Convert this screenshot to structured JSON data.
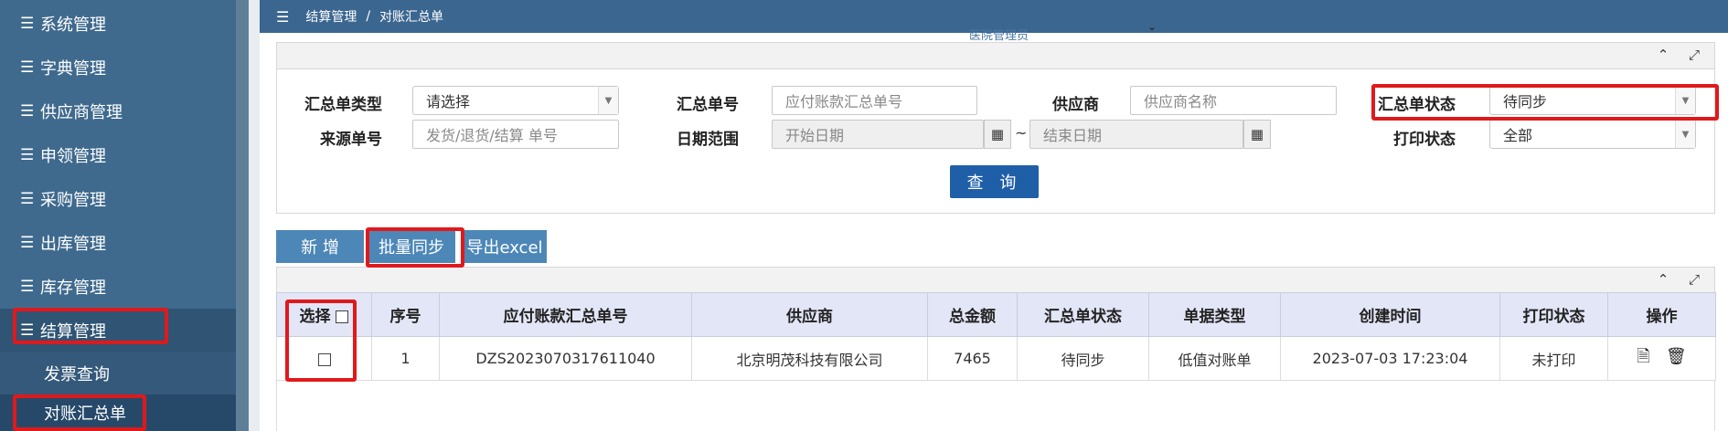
{
  "sidebar": {
    "items": [
      {
        "label": "系统管理",
        "icon": "list-icon"
      },
      {
        "label": "字典管理",
        "icon": "list-icon"
      },
      {
        "label": "供应商管理",
        "icon": "list-icon"
      },
      {
        "label": "申领管理",
        "icon": "list-icon"
      },
      {
        "label": "采购管理",
        "icon": "list-icon"
      },
      {
        "label": "出库管理",
        "icon": "list-icon"
      },
      {
        "label": "库存管理",
        "icon": "list-icon"
      },
      {
        "label": "结算管理",
        "icon": "list-icon"
      }
    ],
    "subitems": [
      {
        "label": "发票查询"
      },
      {
        "label": "对账汇总单"
      }
    ],
    "list_glyph": "☰"
  },
  "header": {
    "breadcrumb": [
      "结算管理",
      "对账汇总单"
    ],
    "separator": "/",
    "user": "医院管理员"
  },
  "search": {
    "type_label": "汇总单类型",
    "type_value": "请选择",
    "no_label": "汇总单号",
    "no_placeholder": "应付账款汇总单号",
    "supplier_label": "供应商",
    "supplier_placeholder": "供应商名称",
    "status_label": "汇总单状态",
    "status_value": "待同步",
    "source_label": "来源单号",
    "source_placeholder": "发货/退货/结算 单号",
    "date_label": "日期范围",
    "date_start_placeholder": "开始日期",
    "date_end_placeholder": "结束日期",
    "date_sep": "~",
    "print_label": "打印状态",
    "print_value": "全部",
    "query_label": "查 询"
  },
  "actions": {
    "add": "新 增",
    "batch_sync": "批量同步",
    "export": "导出excel"
  },
  "table": {
    "headers": [
      "选择",
      "序号",
      "应付账款汇总单号",
      "供应商",
      "总金额",
      "汇总单状态",
      "单据类型",
      "创建时间",
      "打印状态",
      "操作"
    ],
    "rows": [
      {
        "index": "1",
        "no": "DZS2023070317611040",
        "supplier": "北京明茂科技有限公司",
        "amount": "7465",
        "status": "待同步",
        "type": "低值对账单",
        "created": "2023-07-03 17:23:04",
        "print": "未打印"
      }
    ]
  },
  "colors": {
    "sidebar_bg": "#3f6a8e",
    "topbar_bg": "#3b6690",
    "primary_button": "#1f5fa8",
    "action_button": "#4d87b8",
    "highlight": "#e0191b",
    "table_header_bg": "#e3e6f7"
  }
}
